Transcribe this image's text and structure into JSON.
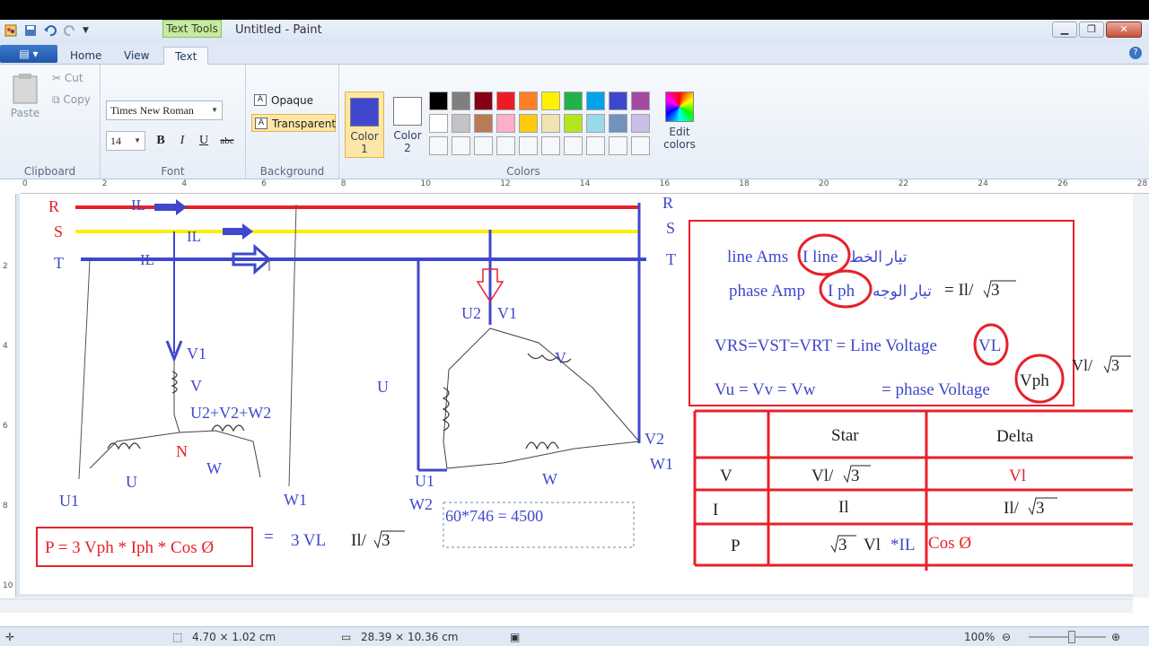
{
  "window": {
    "title": "Untitled - Paint",
    "context_tab": "Text Tools"
  },
  "tabs": {
    "file": "",
    "home": "Home",
    "view": "View",
    "text": "Text"
  },
  "clipboard": {
    "paste": "Paste",
    "cut": "Cut",
    "copy": "Copy",
    "label": "Clipboard"
  },
  "font": {
    "family": "Times New Roman",
    "size": "14",
    "bold": "B",
    "italic": "I",
    "underline": "U",
    "strike": "abc",
    "label": "Font"
  },
  "background": {
    "opaque": "Opaque",
    "transparent": "Transparent",
    "label": "Background"
  },
  "colors": {
    "color1_label": "Color\n1",
    "color1": "#3f48cc",
    "color2_label": "Color\n2",
    "color2": "#ffffff",
    "edit": "Edit colors",
    "label": "Colors",
    "palette": [
      "#000000",
      "#7f7f7f",
      "#880015",
      "#ed1c24",
      "#ff7f27",
      "#fff200",
      "#22b14c",
      "#00a2e8",
      "#3f48cc",
      "#a349a4",
      "#ffffff",
      "#c3c3c3",
      "#b97a57",
      "#ffaec9",
      "#ffc90e",
      "#efe4b0",
      "#b5e61d",
      "#99d9ea",
      "#7092be",
      "#c8bfe7",
      "#f5f7fa",
      "#f5f7fa",
      "#f5f7fa",
      "#f5f7fa",
      "#f5f7fa",
      "#f5f7fa",
      "#f5f7fa",
      "#f5f7fa",
      "#f5f7fa",
      "#f5f7fa"
    ]
  },
  "ruler": [
    "0",
    "2",
    "4",
    "6",
    "8",
    "10",
    "12",
    "14",
    "16",
    "18",
    "20",
    "22",
    "24",
    "26",
    "28"
  ],
  "vruler": [
    "2",
    "4",
    "6",
    "8",
    "10"
  ],
  "status": {
    "selection": "4.70 × 1.02 cm",
    "canvas": "28.39 × 10.36 cm",
    "zoom": "100%"
  },
  "diagram": {
    "lines": {
      "R": "R",
      "S": "S",
      "T": "T",
      "IL": "IL"
    },
    "star": {
      "V1": "V1",
      "V": "V",
      "sum": "U2+V2+W2",
      "N": "N",
      "W": "W",
      "U": "U",
      "U1": "U1",
      "W1": "W1"
    },
    "delta": {
      "U2": "U2",
      "V1": "V1",
      "V": "V",
      "U": "U",
      "V2": "V2",
      "W1": "W1",
      "U1": "U1",
      "W2": "W2",
      "W": "W"
    },
    "textbox": "60*746 = 4500",
    "formula": {
      "p": "P = 3 Vph * Iph * Cos Ø",
      "eq": "=",
      "v": "3 VL",
      "il": "Il/",
      "root": "3"
    },
    "notes": {
      "line_amp": "line Ams",
      "iline": "I line",
      "ar1": "تيار الخط",
      "phase_amp": "phase Amp",
      "iph": "I ph",
      "ar2": "تيار الوجه",
      "il_rt": "= Il/",
      "r3": "3",
      "vrs": "VRS=VST=VRT = Line Voltage",
      "vl": "VL",
      "vu": "Vu = Vv = Vw",
      "pv": "= phase Voltage",
      "vph": "Vph",
      "vl_rt": "Vl/",
      "r3b": "3"
    },
    "table": {
      "headers": [
        "",
        "Star",
        "Delta"
      ],
      "rows": [
        {
          "label": "V",
          "star": "Vl/",
          "star_root": "3",
          "delta": "Vl"
        },
        {
          "label": "I",
          "star": "Il",
          "delta": "Il/",
          "delta_root": "3"
        },
        {
          "label": "P",
          "star_root": "3",
          "star": "Vl",
          "star_il": "*IL",
          "star_cos": "Cos Ø"
        }
      ]
    }
  }
}
